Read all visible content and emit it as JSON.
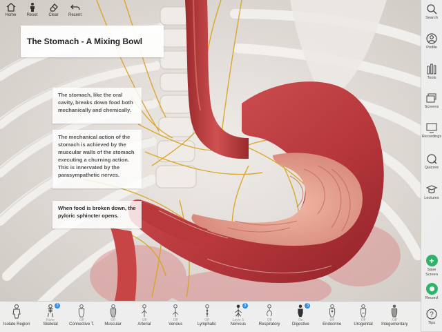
{
  "toolbar": {
    "home_label": "Home",
    "reset_label": "Reset",
    "clear_label": "Clear",
    "recent_label": "Recent"
  },
  "lesson": {
    "title": "The Stomach - A Mixing Bowl",
    "paragraphs": [
      "The stomach, like the oral cavity, breaks down food both mechanically and chemically.",
      "The mechanical action of the stomach is achieved by the muscular walls of the stomach executing a churning action. This is innervated by the parasympathetic nerves.",
      "When food is broken down, the pyloric sphincter opens."
    ]
  },
  "sidebar": {
    "search": "Search",
    "profile": "Profile",
    "tools": "Tools",
    "screens": "Screens",
    "recordings": "Recordings",
    "quizzes": "Quizzes",
    "lectures": "Lectures",
    "save_screen": "Save Screen",
    "record": "Record",
    "tips": "Tips"
  },
  "bottom": {
    "isolate_label": "Isolate Region",
    "systems": [
      {
        "state": "None",
        "name": "Skeletal",
        "icon": "skeleton-icon",
        "badge": "3"
      },
      {
        "state": "Off",
        "name": "Connective T.",
        "icon": "connective-tissue-icon",
        "badge": ""
      },
      {
        "state": "Off",
        "name": "Muscular",
        "icon": "muscle-icon",
        "badge": ""
      },
      {
        "state": "Off",
        "name": "Arterial",
        "icon": "arterial-icon",
        "badge": ""
      },
      {
        "state": "Off",
        "name": "Venous",
        "icon": "venous-icon",
        "badge": ""
      },
      {
        "state": "Off",
        "name": "Lymphatic",
        "icon": "lymphatic-icon",
        "badge": ""
      },
      {
        "state": "Layer 5",
        "name": "Nervous",
        "icon": "nervous-icon",
        "badge": "3"
      },
      {
        "state": "Off",
        "name": "Respiratory",
        "icon": "respiratory-icon",
        "badge": ""
      },
      {
        "state": "On",
        "name": "Digestive",
        "icon": "digestive-icon",
        "badge": "3"
      },
      {
        "state": "Off",
        "name": "Endocrine",
        "icon": "endocrine-icon",
        "badge": ""
      },
      {
        "state": "Off",
        "name": "Urogenital",
        "icon": "urogenital-icon",
        "badge": ""
      },
      {
        "state": "Off",
        "name": "Integumentary",
        "icon": "integumentary-icon",
        "badge": ""
      }
    ]
  },
  "colors": {
    "accent_green": "#2fb36a",
    "badge_blue": "#2f8de4",
    "stomach_red": "#b8383c",
    "nerve_yellow": "#d9a21c"
  }
}
